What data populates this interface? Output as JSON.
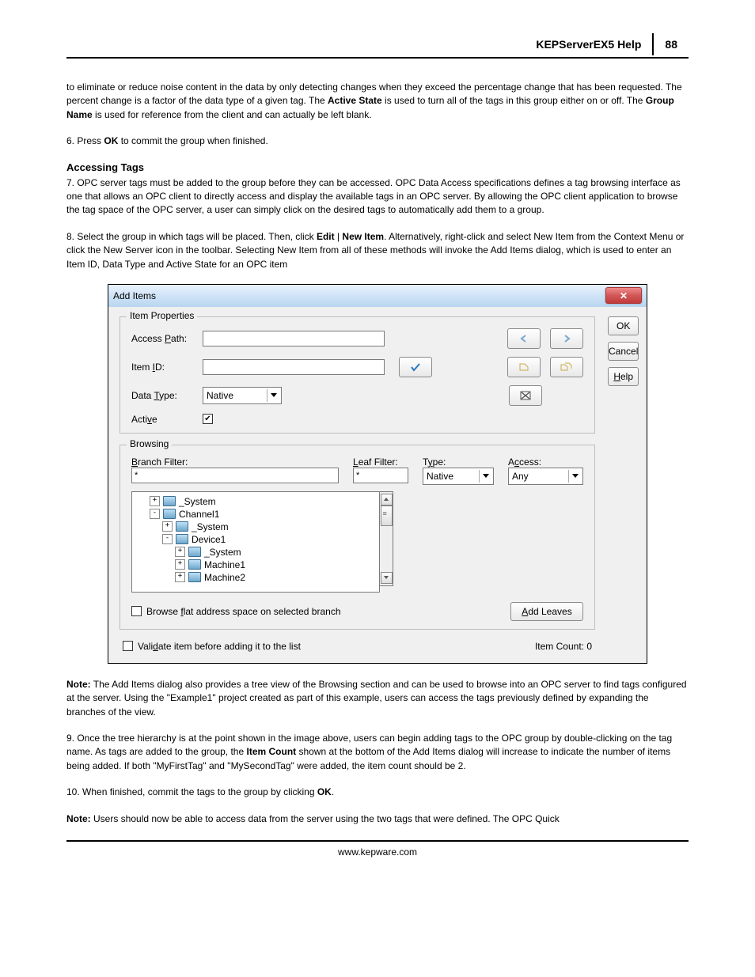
{
  "header": {
    "title": "KEPServerEX5 Help",
    "page": "88"
  },
  "para_intro": "to eliminate or reduce noise content in the data by only detecting changes when they exceed the percentage change that has been requested. The percent change is a factor of the data type of a given tag. The ",
  "active_state_b": "Active State",
  "para_intro2": " is used to turn all of the tags in this group either on or off. The ",
  "group_name_b": "Group Name",
  "para_intro3": " is used for reference from the client and can actually be left blank.",
  "step6_a": "6. Press ",
  "ok_b": "OK",
  "step6_b": " to commit the group when finished.",
  "accessing_heading": "Accessing Tags",
  "step7": "7. OPC server tags must be added to the group before they can be accessed. OPC Data Access specifications defines a tag browsing interface as one that allows an OPC client to directly access and display the available tags in an OPC server. By allowing the OPC client application to browse the tag space of the OPC server, a user can simply click on the desired tags to automatically add them to a group.",
  "step8_a": "8. Select the group in which tags will be placed. Then, click ",
  "edit_b": "Edit",
  "pipe": " | ",
  "newitem_b": "New Item",
  "step8_b": ". Alternatively, right-click and select New Item from the Context Menu or click the New Server icon in the toolbar. Selecting New Item from all of these methods will invoke the Add Items dialog, which is used to enter an Item ID, Data Type and Active State for an OPC item",
  "dialog": {
    "title": "Add Items",
    "group_item": "Item Properties",
    "access_path": "Access Path:",
    "item_id": "Item ID:",
    "data_type": "Data Type:",
    "data_type_val": "Native",
    "active": "Active",
    "ok": "OK",
    "cancel": "Cancel",
    "help": "Help",
    "group_browse": "Browsing",
    "branch_filter": "Branch Filter:",
    "leaf_filter": "Leaf Filter:",
    "type_lab": "Type:",
    "access_lab": "Access:",
    "branch_val": "*",
    "leaf_val": "*",
    "type_val": "Native",
    "access_val": "Any",
    "tree": {
      "n0": "_System",
      "n1": "Channel1",
      "n2": "_System",
      "n3": "Device1",
      "n4": "_System",
      "n5": "Machine1",
      "n6": "Machine2"
    },
    "browse_flat": "Browse flat address space on selected branch",
    "add_leaves": "Add Leaves",
    "validate": "Validate item before adding it to the list",
    "item_count": "Item Count: 0"
  },
  "note1_b": "Note:",
  "note1": " The Add Items dialog also provides a tree view of the Browsing section and can be used to browse into an OPC server to find tags configured at the server. Using the \"Example1\" project created as part of this example, users can access the tags previously defined by expanding the branches of the view.",
  "step9_a": "9. Once the tree hierarchy is at the point shown in the image above, users can begin adding tags to the OPC group by double-clicking on the tag name. As tags are added to the group, the ",
  "item_count_b": "Item Count",
  "step9_b": " shown at the bottom of the Add Items dialog will increase to indicate the number of items being added. If both \"MyFirstTag\" and \"MySecondTag\" were added, the item count should be 2.",
  "step10_a": "10. When finished, commit the tags to the group by clicking ",
  "step10_b": ".",
  "note2": " Users should now be able to access data from the server using the two tags that were defined. The OPC Quick",
  "footer": "www.kepware.com"
}
